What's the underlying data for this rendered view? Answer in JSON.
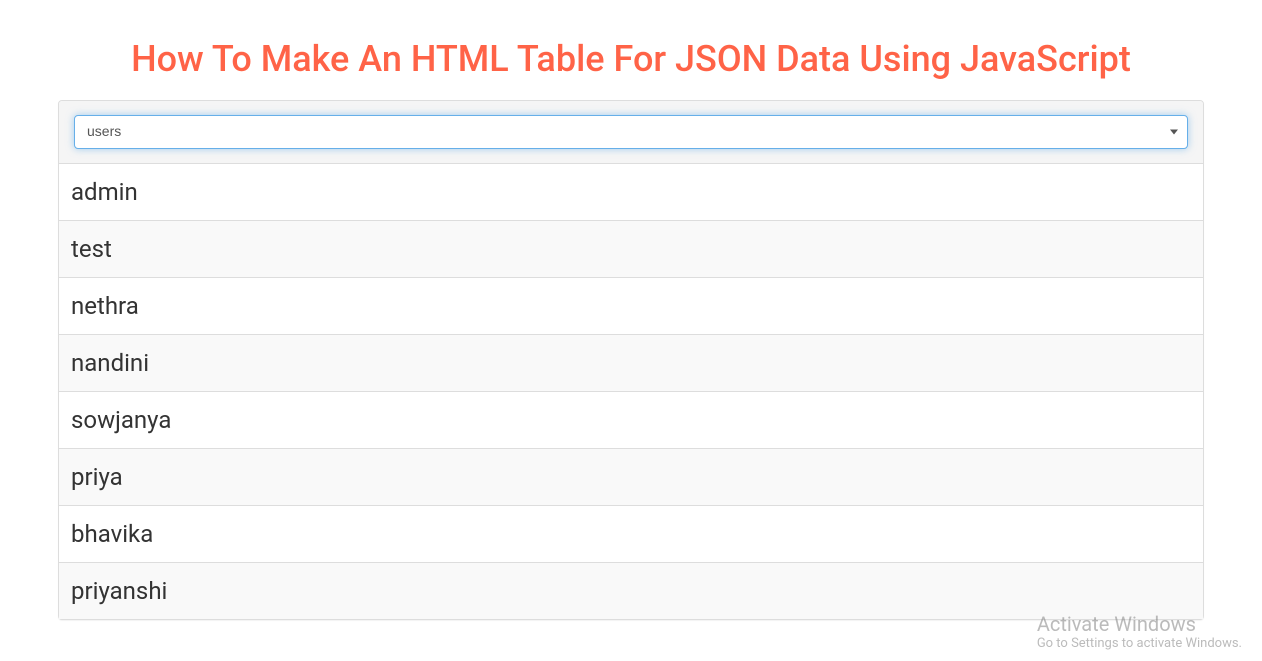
{
  "title": "How To Make An HTML Table For JSON Data Using JavaScript",
  "dropdown": {
    "selected": "users",
    "options": [
      "users"
    ]
  },
  "table": {
    "rows": [
      "admin",
      "test",
      "nethra",
      "nandini",
      "sowjanya",
      "priya",
      "bhavika",
      "priyanshi"
    ]
  },
  "watermark": {
    "title": "Activate Windows",
    "subtitle": "Go to Settings to activate Windows."
  }
}
